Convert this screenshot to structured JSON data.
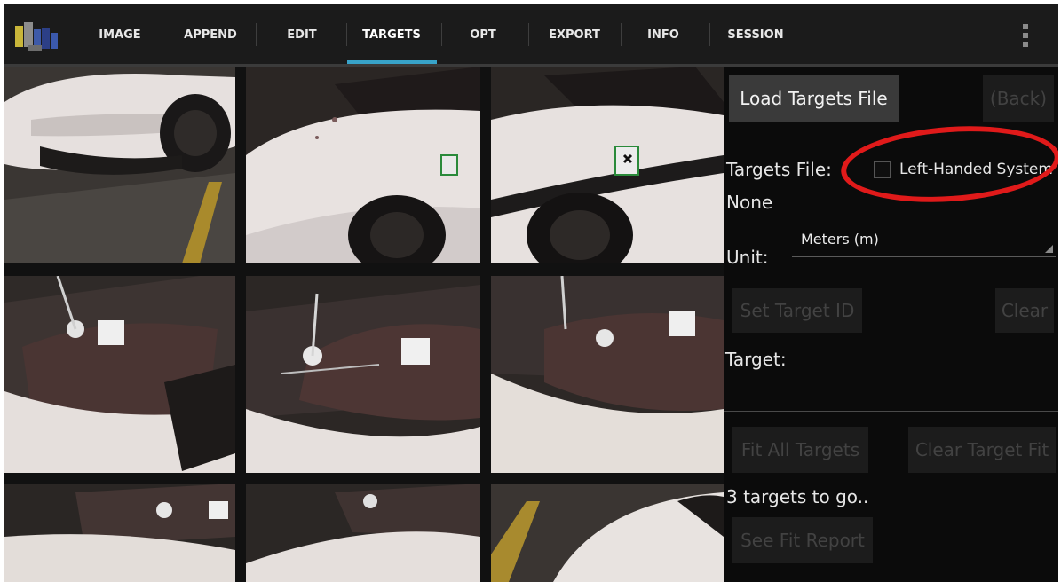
{
  "tabs": [
    {
      "label": "IMAGE"
    },
    {
      "label": "APPEND"
    },
    {
      "label": "EDIT"
    },
    {
      "label": "TARGETS"
    },
    {
      "label": "OPT"
    },
    {
      "label": "EXPORT"
    },
    {
      "label": "INFO"
    },
    {
      "label": "SESSION"
    }
  ],
  "active_tab": "TARGETS",
  "colors": {
    "accent": "#38a3c9",
    "annotation": "#e01a1a"
  },
  "panel": {
    "load_button": "Load Targets File",
    "back_button": "(Back)",
    "targets_file_label": "Targets File:",
    "targets_file_value": "None",
    "left_handed_label": "Left-Handed System",
    "left_handed_checked": false,
    "unit_label": "Unit:",
    "unit_value": "Meters (m)",
    "set_target_button": "Set Target ID",
    "clear_button": "Clear",
    "target_label": "Target:",
    "fit_all_button": "Fit All Targets",
    "clear_fit_button": "Clear Target Fit",
    "status_text": "3 targets to go..",
    "see_fit_button": "See Fit Report"
  },
  "thumbnails": [
    {
      "alt": "car-front-fender"
    },
    {
      "alt": "car-hood-left-targets"
    },
    {
      "alt": "car-side-targets"
    },
    {
      "alt": "windshield-targets-1"
    },
    {
      "alt": "windshield-targets-2"
    },
    {
      "alt": "windshield-targets-3"
    },
    {
      "alt": "windshield-partial-1"
    },
    {
      "alt": "windshield-partial-2"
    },
    {
      "alt": "car-hood-partial"
    }
  ]
}
